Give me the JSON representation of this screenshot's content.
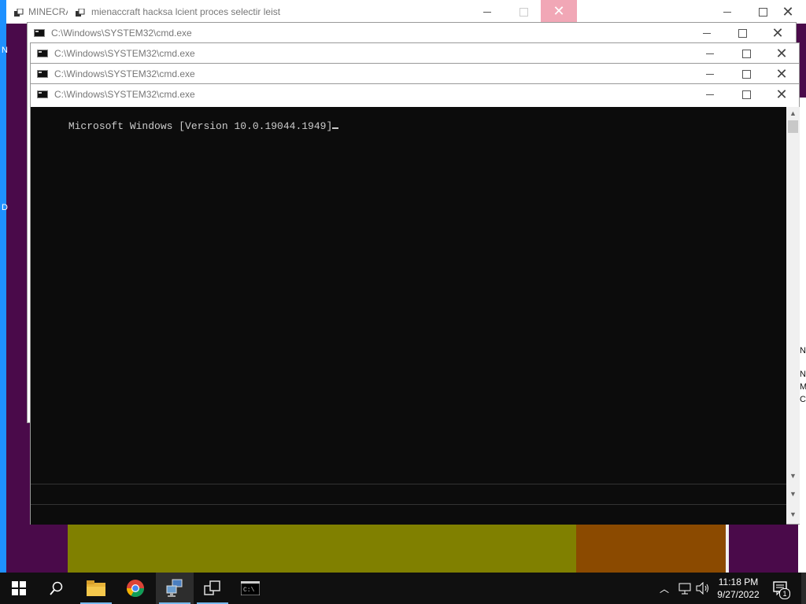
{
  "background_windows": {
    "minecraft_title": "MINECRA",
    "hack_title": "mienaccraft hacksa lcient proces selectir leist"
  },
  "left_edge_letters": [
    "N",
    "D"
  ],
  "right_edge_letters": [
    "N",
    "N",
    "M",
    "CR"
  ],
  "cmd_windows": [
    {
      "title": "C:\\Windows\\SYSTEM32\\cmd.exe"
    },
    {
      "title": "C:\\Windows\\SYSTEM32\\cmd.exe"
    },
    {
      "title": "C:\\Windows\\SYSTEM32\\cmd.exe"
    },
    {
      "title": "C:\\Windows\\SYSTEM32\\cmd.exe"
    }
  ],
  "console": {
    "line1": "Microsoft Windows [Version 10.0.19044.1949]"
  },
  "taskbar": {
    "time": "11:18 PM",
    "date": "9/27/2022",
    "notification_count": "1"
  },
  "colors": {
    "desktop": "#4a0a4a",
    "accent": "#76b9ed",
    "console_bg": "#0c0c0c"
  }
}
